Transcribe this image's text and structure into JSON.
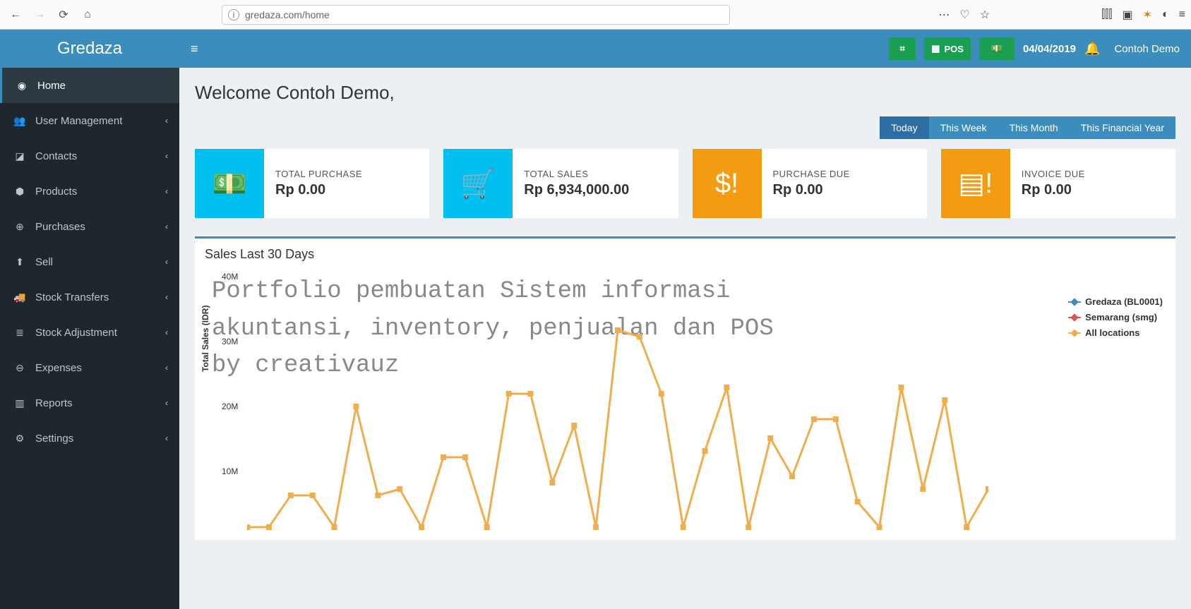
{
  "browser": {
    "url": "gredaza.com/home"
  },
  "brand": "Gredaza",
  "sidebar": {
    "items": [
      {
        "label": "Home",
        "icon": "dashboard",
        "active": true,
        "expandable": false
      },
      {
        "label": "User Management",
        "icon": "users",
        "active": false,
        "expandable": true
      },
      {
        "label": "Contacts",
        "icon": "book",
        "active": false,
        "expandable": true
      },
      {
        "label": "Products",
        "icon": "cubes",
        "active": false,
        "expandable": true
      },
      {
        "label": "Purchases",
        "icon": "plus-circle",
        "active": false,
        "expandable": true
      },
      {
        "label": "Sell",
        "icon": "up-circle",
        "active": false,
        "expandable": true
      },
      {
        "label": "Stock Transfers",
        "icon": "truck",
        "active": false,
        "expandable": true
      },
      {
        "label": "Stock Adjustment",
        "icon": "stack",
        "active": false,
        "expandable": true
      },
      {
        "label": "Expenses",
        "icon": "minus-circle",
        "active": false,
        "expandable": true
      },
      {
        "label": "Reports",
        "icon": "bar-chart",
        "active": false,
        "expandable": true
      },
      {
        "label": "Settings",
        "icon": "gear",
        "active": false,
        "expandable": true
      }
    ]
  },
  "topbar": {
    "pos_label": "POS",
    "date": "04/04/2019",
    "user": "Contoh Demo"
  },
  "welcome": "Welcome Contoh Demo,",
  "filters": {
    "today": "Today",
    "week": "This Week",
    "month": "This Month",
    "year": "This Financial Year",
    "active": "today"
  },
  "cards": [
    {
      "label": "TOTAL PURCHASE",
      "value": "Rp 0.00"
    },
    {
      "label": "TOTAL SALES",
      "value": "Rp 6,934,000.00"
    },
    {
      "label": "PURCHASE DUE",
      "value": "Rp 0.00"
    },
    {
      "label": "INVOICE DUE",
      "value": "Rp 0.00"
    }
  ],
  "chart": {
    "title": "Sales Last 30 Days",
    "ylabel": "Total Sales (IDR)",
    "legend": [
      "Gredaza (BL0001)",
      "Semarang (smg)",
      "All locations"
    ],
    "watermark": "Portfolio pembuatan Sistem informasi\nakuntansi, inventory, penjualan dan POS\nby creativauz",
    "yticks": [
      "40M",
      "30M",
      "20M",
      "10M"
    ]
  },
  "chart_data": {
    "type": "line",
    "ylabel": "Total Sales (IDR)",
    "ylim": [
      0,
      40000000
    ],
    "yticks": [
      10000000,
      20000000,
      30000000,
      40000000
    ],
    "series": [
      {
        "name": "Gredaza (BL0001)",
        "color": "#3c8dbc",
        "values": []
      },
      {
        "name": "Semarang (smg)",
        "color": "#d9534f",
        "values": []
      },
      {
        "name": "All locations",
        "color": "#f0ad4e",
        "values": [
          0,
          0,
          5000000,
          5000000,
          0,
          19000000,
          5000000,
          6000000,
          0,
          11000000,
          11000000,
          0,
          21000000,
          21000000,
          7000000,
          16000000,
          0,
          31000000,
          30000000,
          21000000,
          0,
          12000000,
          22000000,
          0,
          14000000,
          8000000,
          17000000,
          17000000,
          4000000,
          0,
          22000000,
          6000000,
          20000000,
          0,
          6000000
        ]
      }
    ]
  }
}
